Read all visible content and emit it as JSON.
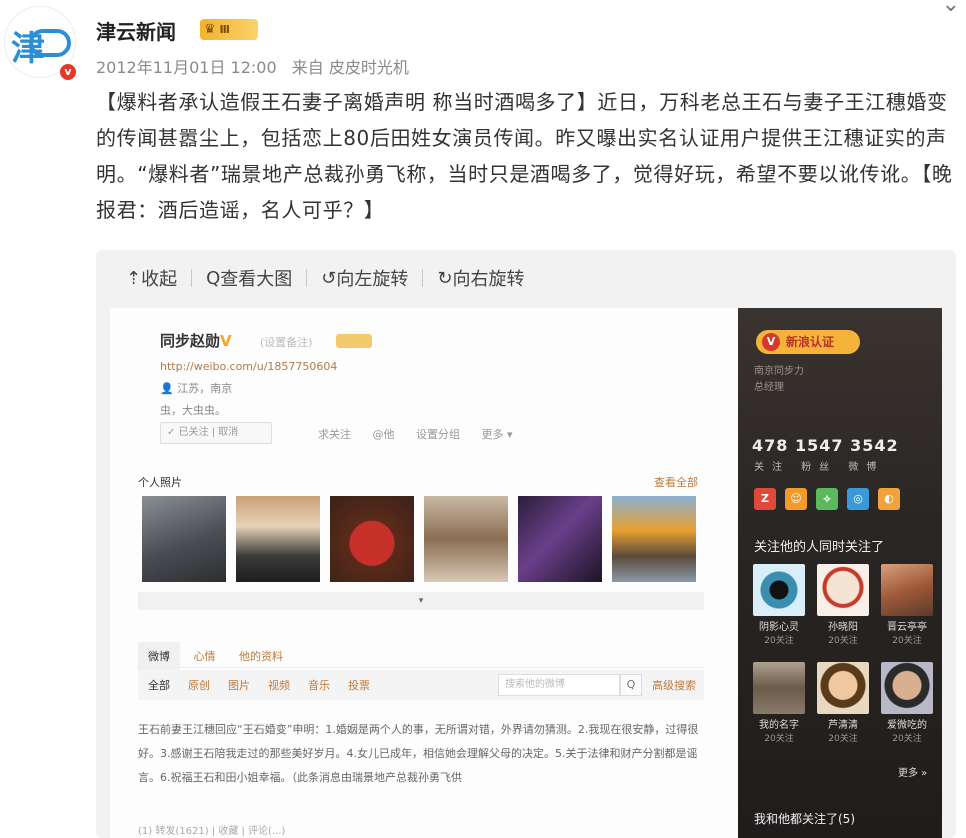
{
  "post": {
    "author": "津云新闻",
    "avatar_mark": "津",
    "vip_badge": "v",
    "rank_label": "Ⅲ",
    "date": "2012年11月01日 12:00",
    "source": "来自 皮皮时光机",
    "more": "⌄",
    "text": "【爆料者承认造假王石妻子离婚声明 称当时酒喝多了】近日，万科老总王石与妻子王江穗婚变的传闻甚嚣尘上，包括恋上80后田姓女演员传闻。昨又曝出实名认证用户提供王江穗证实的声明。“爆料者”瑞景地产总裁孙勇飞称，当时只是酒喝多了，觉得好玩，希望不要以讹传讹。【晚报君：酒后造谣，名人可乎？】"
  },
  "viewer": {
    "collapse": "收起",
    "view_large": "查看大图",
    "rotate_left": "向左旋转",
    "rotate_right": "向右旋转",
    "collapse_icon": "⇡",
    "zoom_icon": "Q",
    "rotl_icon": "↺",
    "rotr_icon": "↻"
  },
  "profile": {
    "name": "同步赵勋",
    "v": "V",
    "remark": "(设置备注)",
    "url": "http://weibo.com/u/1857750604",
    "location": "江苏，南京",
    "intro": "虫，大虫虫。",
    "follow_state": "✓ 已关注 | 取消",
    "actions": [
      "求关注",
      "@他",
      "设置分组",
      "更多 ▾"
    ],
    "photos_title": "个人照片",
    "photos_all": "查看全部",
    "photos_more": "▾",
    "tabs": [
      "微博",
      "心情",
      "他的资料"
    ],
    "filters": [
      "全部",
      "原创",
      "图片",
      "视频",
      "音乐",
      "投票"
    ],
    "search_placeholder": "搜索他的微博",
    "search_btn": "Q",
    "advanced": "高级搜索",
    "weibo_text": "王石前妻王江穗回应“王石婚变”申明：1.婚姻是两个人的事，无所谓对错，外界请勿猜测。2.我现在很安静，过得很好。3.感谢王石陪我走过的那些美好岁月。4.女儿已成年，相信她会理解父母的决定。5.关于法律和财产分割都是谣言。6.祝福王石和田小姐幸福。（此条消息由瑞景地产总裁孙勇飞供",
    "footer": "(1) 转发(1621) | 收藏 | 评论(...)"
  },
  "sidebar": {
    "badge": "新浪认证",
    "badge_icon": "V",
    "sub": [
      "南京同步力",
      "总经理"
    ],
    "stats": "478 1547 3542",
    "stat_labels": "关注 粉丝 微博",
    "icon_letters": [
      "Z",
      "☺",
      "⟡",
      "◎",
      "◐"
    ],
    "icon_colors": [
      "#e0493a",
      "#f29b2a",
      "#5cb85c",
      "#3a9ad9",
      "#f2a23a"
    ],
    "also_follow": "关注他的人同时关注了",
    "people": [
      {
        "name": "阴影心灵",
        "count": "20关注"
      },
      {
        "name": "孙晓阳",
        "count": "20关注"
      },
      {
        "name": "晋云亭亭",
        "count": "20关注"
      },
      {
        "name": "我的名字",
        "count": "20关注"
      },
      {
        "name": "芦清清",
        "count": "20关注"
      },
      {
        "name": "爱微吃的",
        "count": "20关注"
      }
    ],
    "more": "更多 »",
    "both_follow": "我和他都关注了(5)"
  }
}
